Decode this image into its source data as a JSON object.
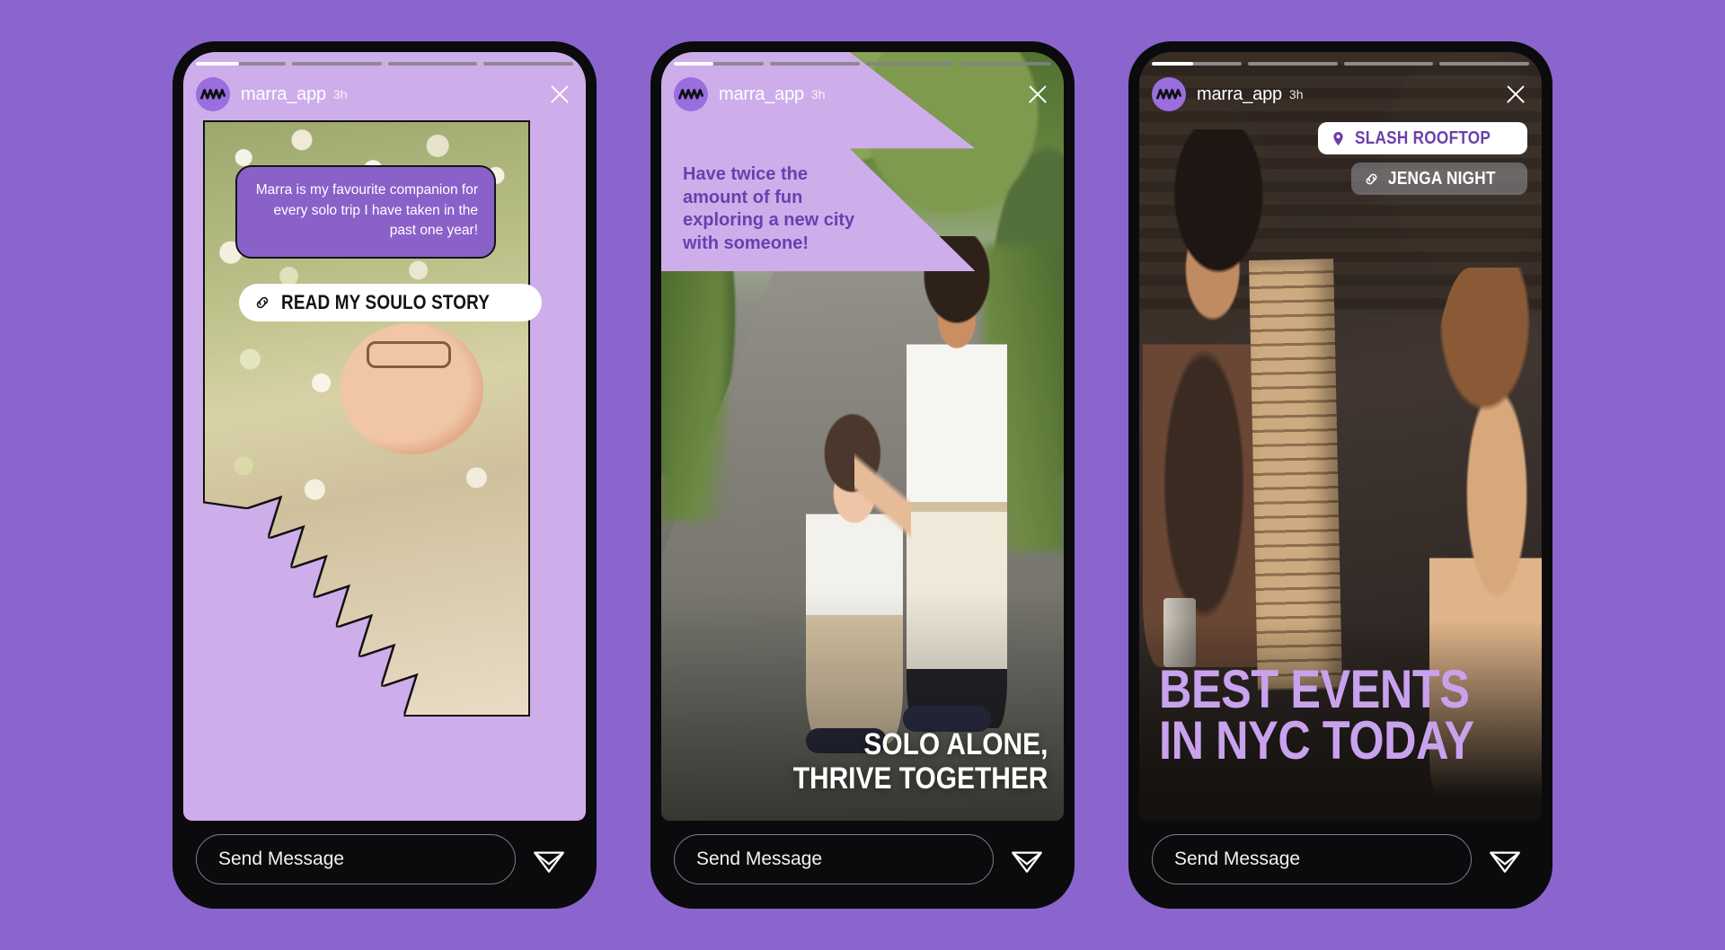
{
  "theme": {
    "page_background": "#8a65ce",
    "story_light_purple": "#cdaeea",
    "brand_purple": "#8a60c9",
    "deep_purple_text": "#6a3fb0",
    "caption_lavender": "#c9a2ee",
    "phone_body": "#0b0b0d"
  },
  "stories": [
    {
      "id": "story-1",
      "handle": "marra_app",
      "timestamp": "3h",
      "progress": {
        "segments": 4,
        "active_index": 0,
        "active_fill_percent": 48
      },
      "close_label": "Close story",
      "bubble_text": "Marra is my favourite companion for every solo trip I have taken in the past one year!",
      "cta_label": "READ MY SOULO STORY",
      "cta_icon": "link-icon",
      "send_placeholder": "Send Message",
      "send_icon": "paper-plane-icon"
    },
    {
      "id": "story-2",
      "handle": "marra_app",
      "timestamp": "3h",
      "progress": {
        "segments": 4,
        "active_index": 0,
        "active_fill_percent": 44
      },
      "close_label": "Close story",
      "overlay_text": "Have twice the amount of fun exploring a new city with someone!",
      "caption_line1": "SOLO ALONE,",
      "caption_line2": "THRIVE TOGETHER",
      "send_placeholder": "Send Message",
      "send_icon": "paper-plane-icon"
    },
    {
      "id": "story-3",
      "handle": "marra_app",
      "timestamp": "3h",
      "progress": {
        "segments": 4,
        "active_index": 0,
        "active_fill_percent": 46
      },
      "close_label": "Close story",
      "tags": [
        {
          "label": "SLASH ROOFTOP",
          "icon": "location-pin-icon",
          "style": "solid-white"
        },
        {
          "label": "JENGA NIGHT",
          "icon": "link-icon",
          "style": "translucent-grey"
        }
      ],
      "caption_line1": "BEST EVENTS",
      "caption_line2": "IN NYC TODAY",
      "send_placeholder": "Send Message",
      "send_icon": "paper-plane-icon"
    }
  ]
}
